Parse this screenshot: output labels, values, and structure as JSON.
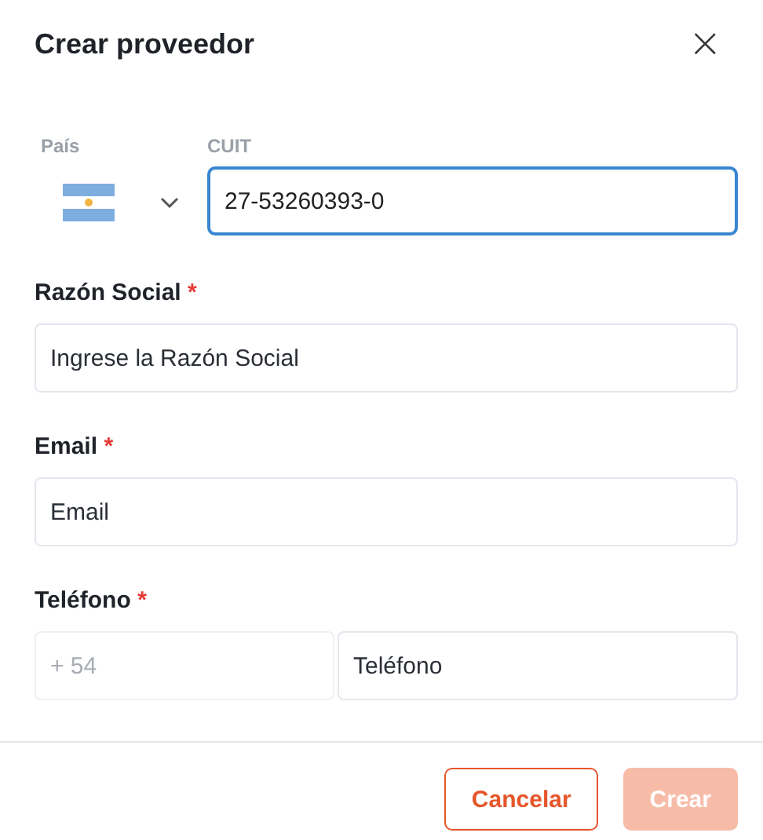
{
  "dialog": {
    "title": "Crear proveedor",
    "close": "×"
  },
  "country": {
    "label": "País"
  },
  "cuit": {
    "label": "CUIT",
    "value": "27-53260393-0",
    "focused": true
  },
  "fields": [
    {
      "label": "Razón Social",
      "required_mark": "*",
      "placeholder": "Ingrese la Razón Social"
    },
    {
      "label": "Email",
      "required_mark": "*",
      "placeholder": "Email"
    }
  ],
  "phone": {
    "label": "Teléfono",
    "required_mark": "*",
    "prefix": {
      "value": "+ 54",
      "disabled": true
    },
    "placeholder": "Teléfono"
  },
  "buttons": [
    {
      "label": "Cancelar",
      "kind": "outline",
      "disabled": false
    },
    {
      "label": "Crear",
      "kind": "primary",
      "disabled": true
    }
  ]
}
